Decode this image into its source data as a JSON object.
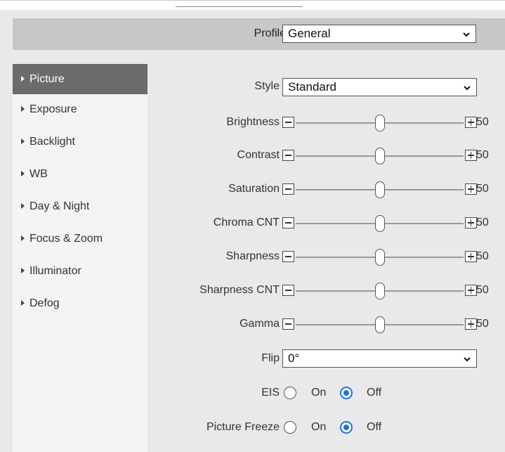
{
  "profile": {
    "label": "Profile",
    "value": "General"
  },
  "sidebar": {
    "items": [
      {
        "label": "Picture",
        "active": true
      },
      {
        "label": "Exposure"
      },
      {
        "label": "Backlight"
      },
      {
        "label": "WB"
      },
      {
        "label": "Day & Night"
      },
      {
        "label": "Focus & Zoom"
      },
      {
        "label": "Illuminator"
      },
      {
        "label": "Defog"
      }
    ]
  },
  "style": {
    "label": "Style",
    "value": "Standard"
  },
  "sliders": [
    {
      "label": "Brightness",
      "value": "50"
    },
    {
      "label": "Contrast",
      "value": "50"
    },
    {
      "label": "Saturation",
      "value": "50"
    },
    {
      "label": "Chroma CNT",
      "value": "50"
    },
    {
      "label": "Sharpness",
      "value": "50"
    },
    {
      "label": "Sharpness CNT",
      "value": "50"
    },
    {
      "label": "Gamma",
      "value": "50"
    }
  ],
  "slider_max": 100,
  "flip": {
    "label": "Flip",
    "value": "0°"
  },
  "eis": {
    "label": "EIS",
    "on_label": "On",
    "off_label": "Off",
    "selected": "Off"
  },
  "picture_freeze": {
    "label": "Picture Freeze",
    "on_label": "On",
    "off_label": "Off",
    "selected": "Off"
  },
  "colors": {
    "accent": "#1a73e8",
    "sidebar_active": "#6b6b6b",
    "header_bar": "#c7c7c7"
  }
}
